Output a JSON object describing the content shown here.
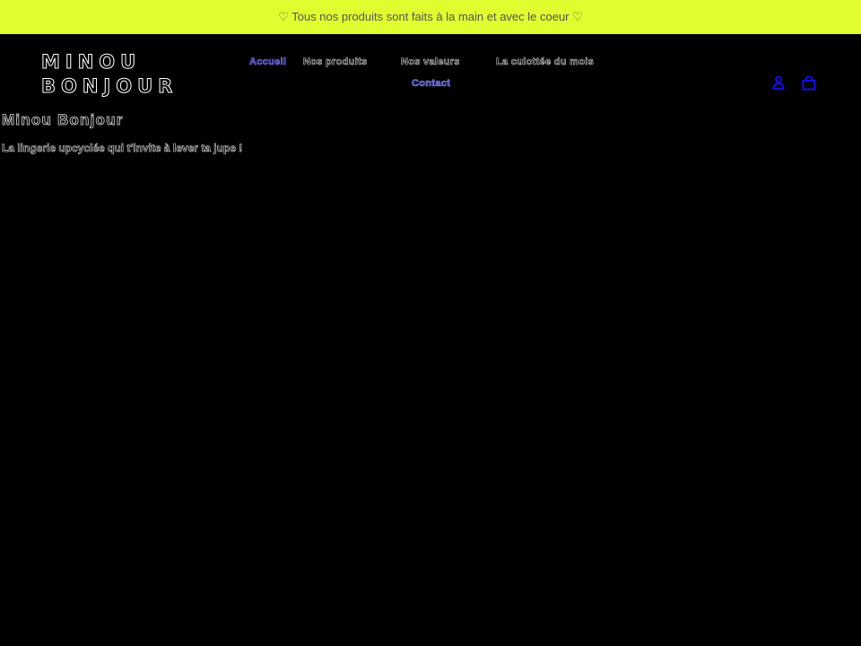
{
  "announcement": {
    "text": "♡ Tous nos produits sont faits à la main et avec le coeur ♡"
  },
  "header": {
    "logo_line1": "MINOU",
    "logo_line2": "BONJOUR",
    "nav": [
      {
        "label": "Accueil"
      },
      {
        "label": "Nos produits"
      },
      {
        "label": "Nos valeurs"
      },
      {
        "label": "La culottée du mois"
      },
      {
        "label": "Contact"
      }
    ],
    "icons": {
      "account": "account-icon",
      "cart": "cart-icon"
    }
  },
  "main": {
    "title": "Minou Bonjour",
    "subtitle": "La lingerie upcyclée qui t'invite à lever ta jupe !"
  },
  "colors": {
    "announcement_bg": "#e1fc2f",
    "background": "#000000",
    "link_active": "#7f7fff",
    "icon_blue": "#1010ff"
  }
}
